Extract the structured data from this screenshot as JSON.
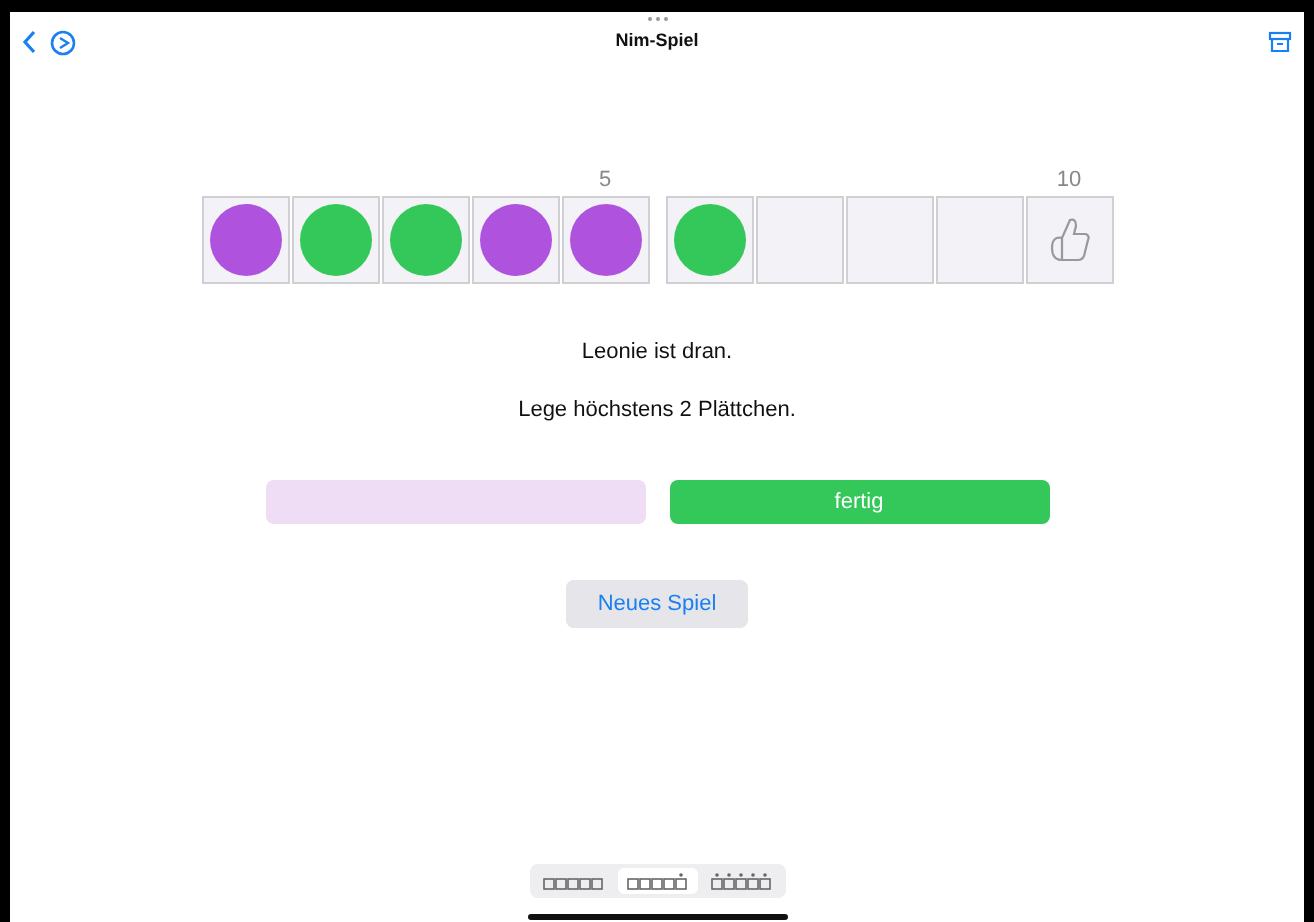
{
  "window": {
    "title": "Nim-Spiel"
  },
  "board": {
    "cells": [
      {
        "kind": "token",
        "color": "#af52de"
      },
      {
        "kind": "token",
        "color": "#34c759"
      },
      {
        "kind": "token",
        "color": "#34c759"
      },
      {
        "kind": "token",
        "color": "#af52de"
      },
      {
        "kind": "token",
        "color": "#af52de",
        "label": "5"
      },
      {
        "kind": "token",
        "color": "#34c759"
      },
      {
        "kind": "empty"
      },
      {
        "kind": "empty"
      },
      {
        "kind": "empty"
      },
      {
        "kind": "goal",
        "label": "10"
      }
    ]
  },
  "messages": [
    "Leonie ist dran.",
    "Lege höchstens 2 Plättchen."
  ],
  "actions": {
    "player_button": {
      "color": "#efdcf5"
    },
    "done_button": {
      "label": "fertig"
    }
  },
  "new_game_button": {
    "label": "Neues Spiel"
  },
  "variant_picker": [
    {
      "kind": "plain",
      "selected": false
    },
    {
      "kind": "last",
      "selected": true
    },
    {
      "kind": "all",
      "selected": false
    }
  ]
}
